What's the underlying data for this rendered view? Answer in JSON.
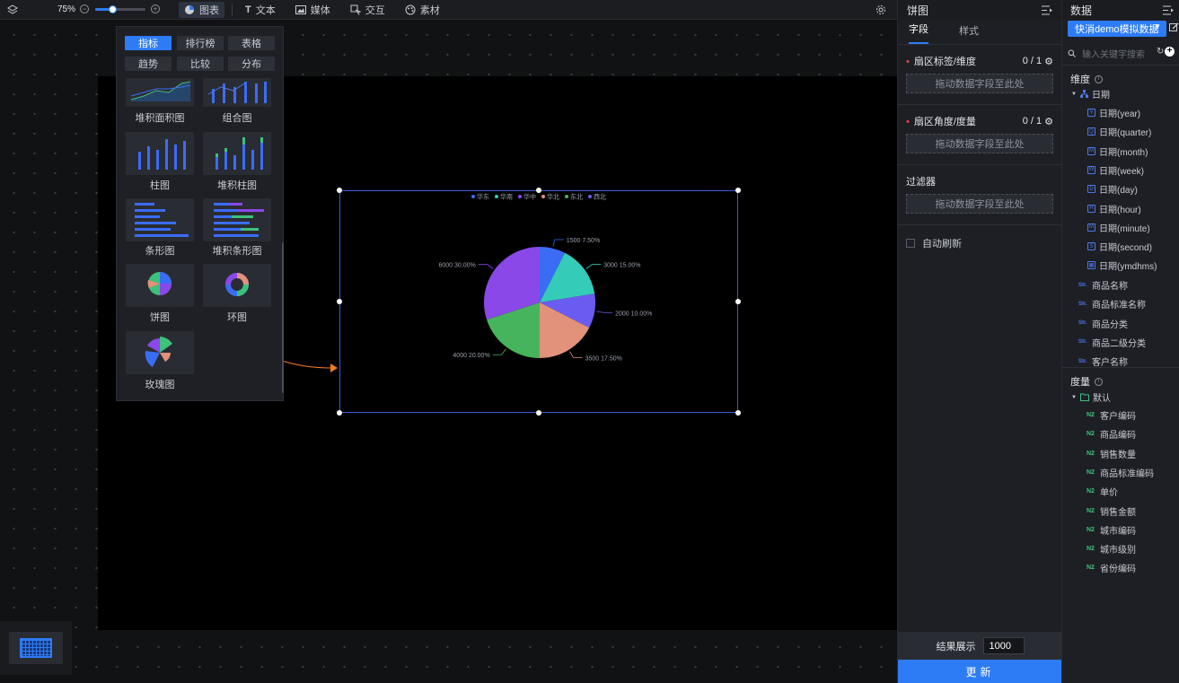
{
  "toolbar": {
    "zoom": "75%",
    "zoom_fraction": 0.35,
    "tabs": [
      {
        "label": "图表",
        "icon": "pie-chart-icon",
        "active": true
      },
      {
        "label": "文本",
        "icon": "text-icon"
      },
      {
        "label": "媒体",
        "icon": "image-icon"
      },
      {
        "label": "交互",
        "icon": "interaction-icon"
      },
      {
        "label": "素材",
        "icon": "palette-icon"
      }
    ]
  },
  "chart_picker": {
    "categories": [
      "指标",
      "排行榜",
      "表格",
      "趋势",
      "比较",
      "分布"
    ],
    "active_category": "指标",
    "charts": [
      "堆积面积图",
      "组合图",
      "柱图",
      "堆积柱图",
      "条形图",
      "堆积条形图",
      "饼图",
      "环图",
      "玫瑰图"
    ]
  },
  "chart_data": {
    "type": "pie",
    "legend": [
      "华东",
      "华南",
      "华中",
      "华北",
      "东北",
      "西北"
    ],
    "legend_position": "top",
    "slices": [
      {
        "value": 1500,
        "label": "1500 7.50%",
        "color": "#3b6cf6"
      },
      {
        "value": 3000,
        "label": "3000 15.00%",
        "color": "#35cbb9"
      },
      {
        "value": 2000,
        "label": "2000 10.00%",
        "color": "#6b5cf1"
      },
      {
        "value": 3500,
        "label": "3500 17.50%",
        "color": "#e2917a"
      },
      {
        "value": 4000,
        "label": "4000 20.00%",
        "color": "#46b45c"
      },
      {
        "value": 6000,
        "label": "6000 30.00%",
        "color": "#8a48e8"
      }
    ],
    "legend_colors": [
      "#3b6cf6",
      "#35cbb9",
      "#8a48e8",
      "#e2917a",
      "#46b45c",
      "#6b5cf1"
    ]
  },
  "config": {
    "title": "饼图",
    "tabs": [
      "字段",
      "样式"
    ],
    "sections": [
      {
        "title": "扇区标签/维度",
        "count": "0 / 1",
        "drop": "拖动数据字段至此处"
      },
      {
        "title": "扇区角度/度量",
        "count": "0 / 1",
        "drop": "拖动数据字段至此处"
      }
    ],
    "filter": {
      "title": "过滤器",
      "drop": "拖动数据字段至此处"
    },
    "auto_refresh": "自动刷新",
    "result_label": "结果展示",
    "result_value": "1000",
    "update": "更新"
  },
  "data_panel": {
    "title": "数据",
    "dataset": "快消demo模拟数据",
    "search_placeholder": "输入关键字搜索",
    "dimensions_title": "维度",
    "date_group": "日期",
    "date_fields": [
      {
        "label": "日期(year)",
        "glyph": "Y"
      },
      {
        "label": "日期(quarter)",
        "glyph": "Q"
      },
      {
        "label": "日期(month)",
        "glyph": "M"
      },
      {
        "label": "日期(week)",
        "glyph": "W"
      },
      {
        "label": "日期(day)",
        "glyph": "D"
      },
      {
        "label": "日期(hour)",
        "glyph": "H"
      },
      {
        "label": "日期(minute)",
        "glyph": "M"
      },
      {
        "label": "日期(second)",
        "glyph": "S"
      },
      {
        "label": "日期(ymdhms)",
        "glyph": "▦"
      }
    ],
    "string_fields": [
      "商品名称",
      "商品标准名称",
      "商品分类",
      "商品二级分类",
      "客户名称"
    ],
    "str_glyph": "Str.",
    "measures_title": "度量",
    "measure_group": "默认",
    "num_glyph": "N2",
    "measure_fields": [
      "客户编码",
      "商品编码",
      "销售数量",
      "商品标准编码",
      "单价",
      "销售金额",
      "城市编码",
      "城市级别",
      "省份编码"
    ]
  }
}
